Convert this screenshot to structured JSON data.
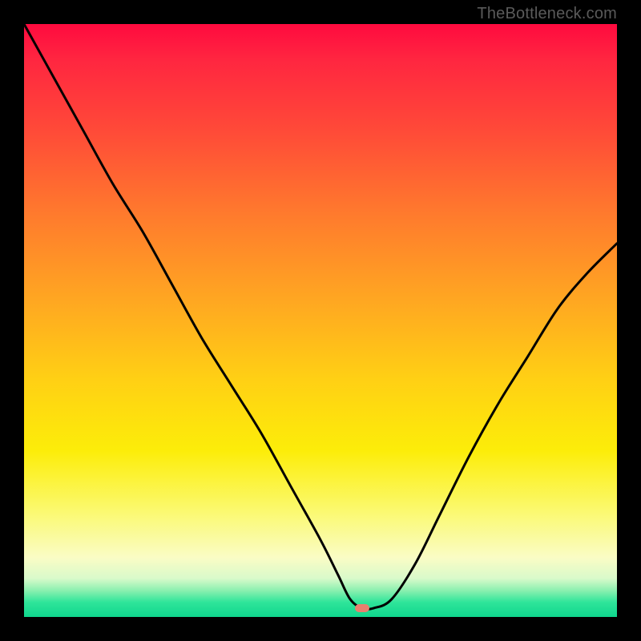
{
  "watermark": "TheBottleneck.com",
  "colors": {
    "page_bg": "#000000",
    "curve": "#000000",
    "marker": "#e87f6e",
    "gradient_top": "#ff0a3f",
    "gradient_bottom": "#0fd68d"
  },
  "chart_data": {
    "type": "line",
    "title": "",
    "xlabel": "",
    "ylabel": "",
    "xlim": [
      0,
      100
    ],
    "ylim": [
      0,
      100
    ],
    "grid": false,
    "legend": false,
    "marker": {
      "x": 57,
      "y": 1.5
    },
    "series": [
      {
        "name": "bottleneck-curve",
        "x": [
          0,
          5,
          10,
          15,
          20,
          25,
          30,
          35,
          40,
          45,
          50,
          53,
          55,
          57,
          59,
          62,
          66,
          70,
          75,
          80,
          85,
          90,
          95,
          100
        ],
        "values": [
          100,
          91,
          82,
          73,
          65,
          56,
          47,
          39,
          31,
          22,
          13,
          7,
          3,
          1.5,
          1.5,
          3,
          9,
          17,
          27,
          36,
          44,
          52,
          58,
          63
        ]
      }
    ]
  }
}
